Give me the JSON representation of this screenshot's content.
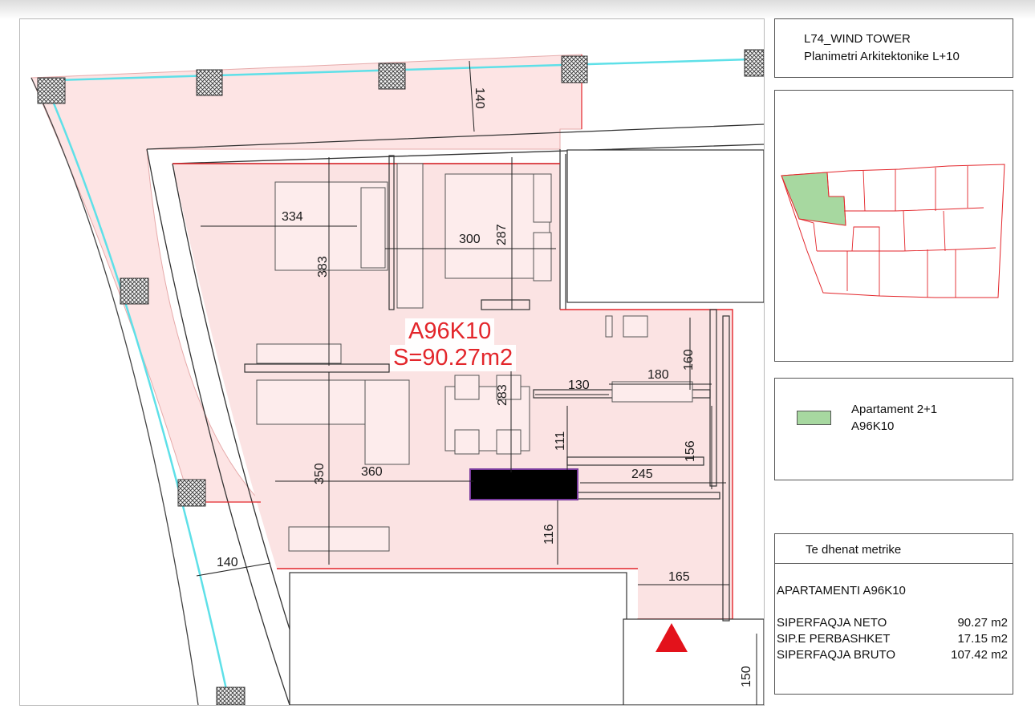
{
  "title_block": {
    "line1": "L74_WIND TOWER",
    "line2": "Planimetri Arkitektonike L+10"
  },
  "apartment_label": {
    "code": "A96K10",
    "area": "S=90.27m2"
  },
  "dimensions": {
    "d140_top": "140",
    "d334": "334",
    "d383": "383",
    "d300": "300",
    "d287": "287",
    "d283": "283",
    "d160": "160",
    "d180": "180",
    "d130": "130",
    "d111": "111",
    "d156": "156",
    "d245": "245",
    "d350": "350",
    "d360": "360",
    "d116": "116",
    "d165": "165",
    "d140_left": "140",
    "d150": "150"
  },
  "legend": {
    "label": "Apartament 2+1",
    "code": "A96K10",
    "swatch_color": "#a7d8a0"
  },
  "metrics": {
    "header": "Te dhenat metrike",
    "apartment": "APARTAMENTI A96K10",
    "rows": [
      {
        "label": "SIPERFAQJA NETO",
        "value": "90.27 m2"
      },
      {
        "label": "SIP.E PERBASHKET",
        "value": "17.15 m2"
      },
      {
        "label": "SIPERFAQJA BRUTO",
        "value": "107.42 m2"
      }
    ]
  },
  "colors": {
    "apartment_fill": "#fbe3e3",
    "wall_red": "#e3262b",
    "cyan_line": "#5ee0e8",
    "highlight_green": "#a7d8a0"
  }
}
